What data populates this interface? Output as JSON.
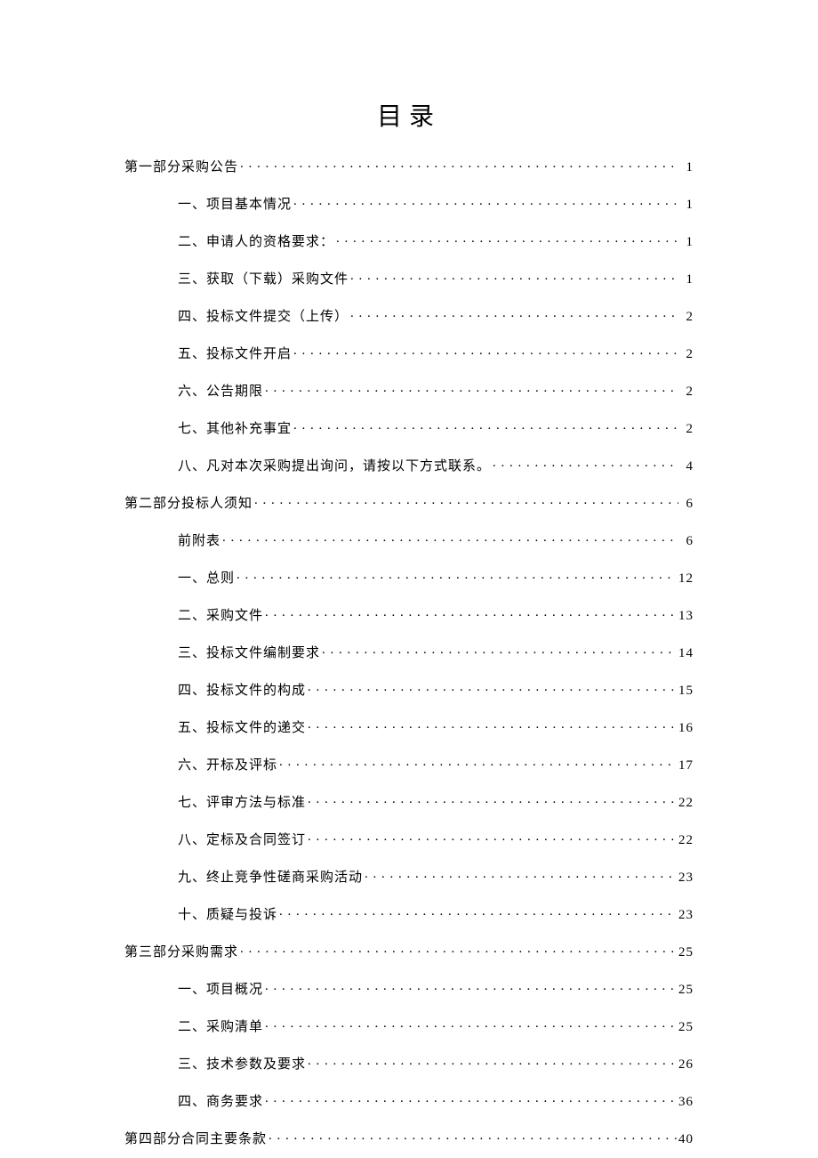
{
  "title": "目录",
  "toc": [
    {
      "level": 0,
      "label": "第一部分采购公告",
      "page": "1"
    },
    {
      "level": 1,
      "label": "一、项目基本情况",
      "page": "1"
    },
    {
      "level": 1,
      "label": "二、申请人的资格要求：",
      "page": "1"
    },
    {
      "level": 1,
      "label": "三、获取（下载）采购文件",
      "page": "1"
    },
    {
      "level": 1,
      "label": "四、投标文件提交（上传）",
      "page": "2"
    },
    {
      "level": 1,
      "label": "五、投标文件开启",
      "page": "2"
    },
    {
      "level": 1,
      "label": "六、公告期限",
      "page": "2"
    },
    {
      "level": 1,
      "label": "七、其他补充事宜",
      "page": "2"
    },
    {
      "level": 1,
      "label": "八、凡对本次采购提出询问，请按以下方式联系。",
      "page": "4"
    },
    {
      "level": 0,
      "label": "第二部分投标人须知",
      "page": "6"
    },
    {
      "level": 1,
      "label": "前附表",
      "page": "6"
    },
    {
      "level": 1,
      "label": "一、总则",
      "page": "12"
    },
    {
      "level": 1,
      "label": "二、采购文件",
      "page": "13"
    },
    {
      "level": 1,
      "label": "三、投标文件编制要求",
      "page": "14"
    },
    {
      "level": 1,
      "label": "四、投标文件的构成",
      "page": "15"
    },
    {
      "level": 1,
      "label": "五、投标文件的递交",
      "page": "16"
    },
    {
      "level": 1,
      "label": "六、开标及评标",
      "page": "17"
    },
    {
      "level": 1,
      "label": "七、评审方法与标准",
      "page": "22"
    },
    {
      "level": 1,
      "label": "八、定标及合同签订",
      "page": "22"
    },
    {
      "level": 1,
      "label": "九、终止竞争性磋商采购活动",
      "page": "23"
    },
    {
      "level": 1,
      "label": "十、质疑与投诉",
      "page": "23"
    },
    {
      "level": 0,
      "label": "第三部分采购需求",
      "page": "25"
    },
    {
      "level": 1,
      "label": "一、项目概况",
      "page": "25"
    },
    {
      "level": 1,
      "label": "二、采购清单",
      "page": "25"
    },
    {
      "level": 1,
      "label": "三、技术参数及要求",
      "page": "26"
    },
    {
      "level": 1,
      "label": "四、商务要求",
      "page": "36"
    },
    {
      "level": 0,
      "label": "第四部分合同主要条款",
      "page": "40"
    }
  ]
}
